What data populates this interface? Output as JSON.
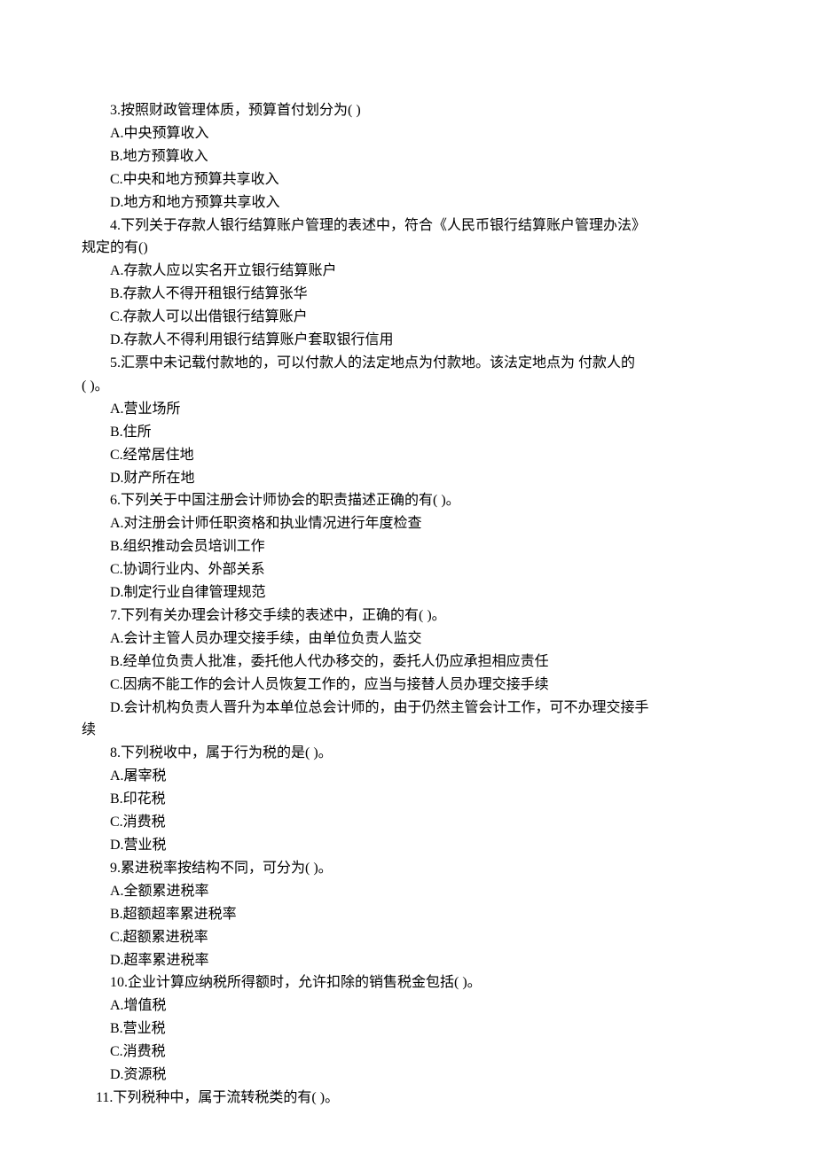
{
  "questions": [
    {
      "stem": "3.按照财政管理体质，预算首付划分为( )",
      "options": [
        "A.中央预算收入",
        "B.地方预算收入",
        "C.中央和地方预算共享收入",
        "D.地方和地方预算共享收入"
      ]
    },
    {
      "stem": "4.下列关于存款人银行结算账户管理的表述中，符合《人民币银行结算账户管理办法》",
      "continuation": "规定的有()",
      "options": [
        "A.存款人应以实名开立银行结算账户",
        "B.存款人不得开租银行结算张华",
        "C.存款人可以出借银行结算账户",
        "D.存款人不得利用银行结算账户套取银行信用"
      ]
    },
    {
      "stem": "5.汇票中未记载付款地的，可以付款人的法定地点为付款地。该法定地点为 付款人的",
      "continuation": "( )。",
      "options": [
        "A.营业场所",
        "B.住所",
        "C.经常居住地",
        "D.财产所在地"
      ]
    },
    {
      "stem": "6.下列关于中国注册会计师协会的职责描述正确的有( )。",
      "options": [
        "A.对注册会计师任职资格和执业情况进行年度检查",
        "B.组织推动会员培训工作",
        "C.协调行业内、外部关系",
        "D.制定行业自律管理规范"
      ]
    },
    {
      "stem": "7.下列有关办理会计移交手续的表述中，正确的有( )。",
      "options": [
        "A.会计主管人员办理交接手续，由单位负责人监交",
        "B.经单位负责人批准，委托他人代办移交的，委托人仍应承担相应责任",
        "C.因病不能工作的会计人员恢复工作的，应当与接替人员办理交接手续",
        "D.会计机构负责人晋升为本单位总会计师的，由于仍然主管会计工作，可不办理交接手"
      ],
      "tail": "续"
    },
    {
      "stem": "8.下列税收中，属于行为税的是( )。",
      "options": [
        "A.屠宰税",
        "B.印花税",
        "C.消费税",
        "D.营业税"
      ]
    },
    {
      "stem": "9.累进税率按结构不同，可分为( )。",
      "options": [
        "A.全额累进税率",
        "B.超额超率累进税率",
        "C.超额累进税率",
        "D.超率累进税率"
      ]
    },
    {
      "stem": "10.企业计算应纳税所得额时，允许扣除的销售税金包括( )。",
      "options": [
        "A.增值税",
        "B.营业税",
        "C.消费税",
        "D.资源税"
      ]
    },
    {
      "stem": "11.下列税种中，属于流转税类的有( )。",
      "options": []
    }
  ]
}
